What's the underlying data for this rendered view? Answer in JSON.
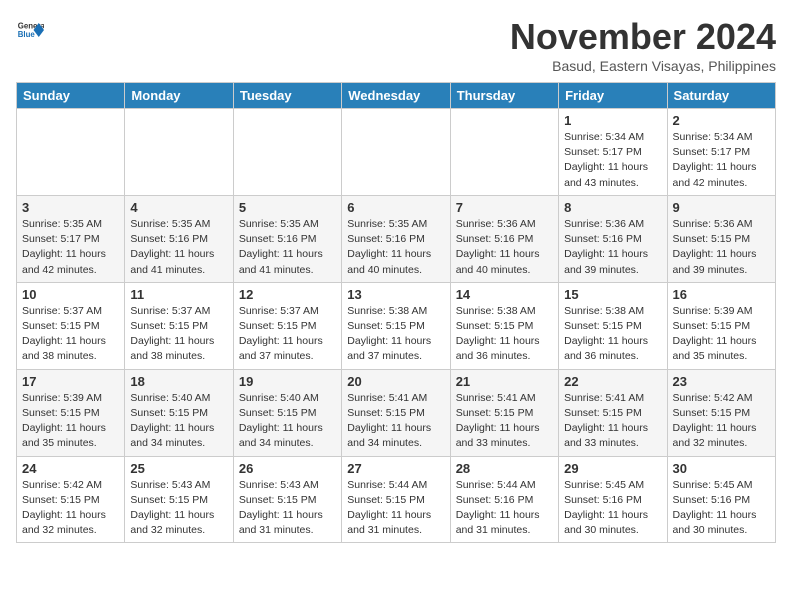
{
  "header": {
    "logo_general": "General",
    "logo_blue": "Blue",
    "month_title": "November 2024",
    "location": "Basud, Eastern Visayas, Philippines"
  },
  "weekdays": [
    "Sunday",
    "Monday",
    "Tuesday",
    "Wednesday",
    "Thursday",
    "Friday",
    "Saturday"
  ],
  "weeks": [
    [
      {
        "day": "",
        "info": ""
      },
      {
        "day": "",
        "info": ""
      },
      {
        "day": "",
        "info": ""
      },
      {
        "day": "",
        "info": ""
      },
      {
        "day": "",
        "info": ""
      },
      {
        "day": "1",
        "info": "Sunrise: 5:34 AM\nSunset: 5:17 PM\nDaylight: 11 hours\nand 43 minutes."
      },
      {
        "day": "2",
        "info": "Sunrise: 5:34 AM\nSunset: 5:17 PM\nDaylight: 11 hours\nand 42 minutes."
      }
    ],
    [
      {
        "day": "3",
        "info": "Sunrise: 5:35 AM\nSunset: 5:17 PM\nDaylight: 11 hours\nand 42 minutes."
      },
      {
        "day": "4",
        "info": "Sunrise: 5:35 AM\nSunset: 5:16 PM\nDaylight: 11 hours\nand 41 minutes."
      },
      {
        "day": "5",
        "info": "Sunrise: 5:35 AM\nSunset: 5:16 PM\nDaylight: 11 hours\nand 41 minutes."
      },
      {
        "day": "6",
        "info": "Sunrise: 5:35 AM\nSunset: 5:16 PM\nDaylight: 11 hours\nand 40 minutes."
      },
      {
        "day": "7",
        "info": "Sunrise: 5:36 AM\nSunset: 5:16 PM\nDaylight: 11 hours\nand 40 minutes."
      },
      {
        "day": "8",
        "info": "Sunrise: 5:36 AM\nSunset: 5:16 PM\nDaylight: 11 hours\nand 39 minutes."
      },
      {
        "day": "9",
        "info": "Sunrise: 5:36 AM\nSunset: 5:15 PM\nDaylight: 11 hours\nand 39 minutes."
      }
    ],
    [
      {
        "day": "10",
        "info": "Sunrise: 5:37 AM\nSunset: 5:15 PM\nDaylight: 11 hours\nand 38 minutes."
      },
      {
        "day": "11",
        "info": "Sunrise: 5:37 AM\nSunset: 5:15 PM\nDaylight: 11 hours\nand 38 minutes."
      },
      {
        "day": "12",
        "info": "Sunrise: 5:37 AM\nSunset: 5:15 PM\nDaylight: 11 hours\nand 37 minutes."
      },
      {
        "day": "13",
        "info": "Sunrise: 5:38 AM\nSunset: 5:15 PM\nDaylight: 11 hours\nand 37 minutes."
      },
      {
        "day": "14",
        "info": "Sunrise: 5:38 AM\nSunset: 5:15 PM\nDaylight: 11 hours\nand 36 minutes."
      },
      {
        "day": "15",
        "info": "Sunrise: 5:38 AM\nSunset: 5:15 PM\nDaylight: 11 hours\nand 36 minutes."
      },
      {
        "day": "16",
        "info": "Sunrise: 5:39 AM\nSunset: 5:15 PM\nDaylight: 11 hours\nand 35 minutes."
      }
    ],
    [
      {
        "day": "17",
        "info": "Sunrise: 5:39 AM\nSunset: 5:15 PM\nDaylight: 11 hours\nand 35 minutes."
      },
      {
        "day": "18",
        "info": "Sunrise: 5:40 AM\nSunset: 5:15 PM\nDaylight: 11 hours\nand 34 minutes."
      },
      {
        "day": "19",
        "info": "Sunrise: 5:40 AM\nSunset: 5:15 PM\nDaylight: 11 hours\nand 34 minutes."
      },
      {
        "day": "20",
        "info": "Sunrise: 5:41 AM\nSunset: 5:15 PM\nDaylight: 11 hours\nand 34 minutes."
      },
      {
        "day": "21",
        "info": "Sunrise: 5:41 AM\nSunset: 5:15 PM\nDaylight: 11 hours\nand 33 minutes."
      },
      {
        "day": "22",
        "info": "Sunrise: 5:41 AM\nSunset: 5:15 PM\nDaylight: 11 hours\nand 33 minutes."
      },
      {
        "day": "23",
        "info": "Sunrise: 5:42 AM\nSunset: 5:15 PM\nDaylight: 11 hours\nand 32 minutes."
      }
    ],
    [
      {
        "day": "24",
        "info": "Sunrise: 5:42 AM\nSunset: 5:15 PM\nDaylight: 11 hours\nand 32 minutes."
      },
      {
        "day": "25",
        "info": "Sunrise: 5:43 AM\nSunset: 5:15 PM\nDaylight: 11 hours\nand 32 minutes."
      },
      {
        "day": "26",
        "info": "Sunrise: 5:43 AM\nSunset: 5:15 PM\nDaylight: 11 hours\nand 31 minutes."
      },
      {
        "day": "27",
        "info": "Sunrise: 5:44 AM\nSunset: 5:15 PM\nDaylight: 11 hours\nand 31 minutes."
      },
      {
        "day": "28",
        "info": "Sunrise: 5:44 AM\nSunset: 5:16 PM\nDaylight: 11 hours\nand 31 minutes."
      },
      {
        "day": "29",
        "info": "Sunrise: 5:45 AM\nSunset: 5:16 PM\nDaylight: 11 hours\nand 30 minutes."
      },
      {
        "day": "30",
        "info": "Sunrise: 5:45 AM\nSunset: 5:16 PM\nDaylight: 11 hours\nand 30 minutes."
      }
    ]
  ]
}
